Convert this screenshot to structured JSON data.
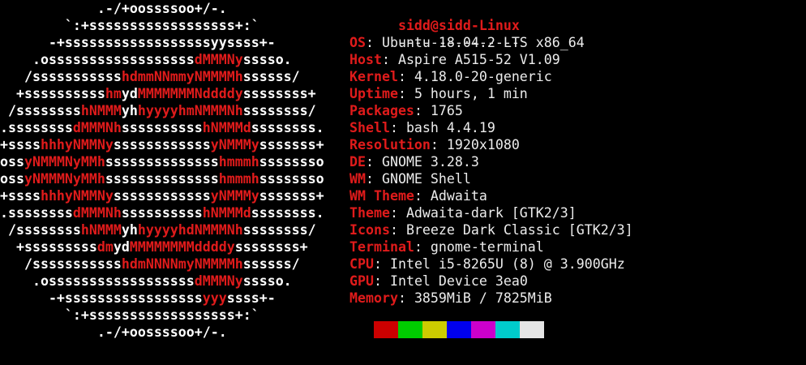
{
  "logo": {
    "lines": [
      [
        {
          "t": "            .-/+oossssoo+/-.",
          "c": "w"
        }
      ],
      [
        {
          "t": "        `:+ssssssssssssssssss+:`",
          "c": "w"
        }
      ],
      [
        {
          "t": "      -+ssssssssssssssssssyyssss+-",
          "c": "w"
        }
      ],
      [
        {
          "t": "    .ossssssssssssssssss",
          "c": "w"
        },
        {
          "t": "dMMMNy",
          "c": "r"
        },
        {
          "t": "sssso.",
          "c": "w"
        }
      ],
      [
        {
          "t": "   /sssssssssss",
          "c": "w"
        },
        {
          "t": "hdmmNNmmyNMMMMh",
          "c": "r"
        },
        {
          "t": "ssssss/",
          "c": "w"
        }
      ],
      [
        {
          "t": "  +ssssssssss",
          "c": "w"
        },
        {
          "t": "hm",
          "c": "r"
        },
        {
          "t": "yd",
          "c": "w"
        },
        {
          "t": "MMMMMMMNddddy",
          "c": "r"
        },
        {
          "t": "ssssssss+",
          "c": "w"
        }
      ],
      [
        {
          "t": " /ssssssss",
          "c": "w"
        },
        {
          "t": "hNMMM",
          "c": "r"
        },
        {
          "t": "yh",
          "c": "w"
        },
        {
          "t": "hyyyyhmNMMMNh",
          "c": "r"
        },
        {
          "t": "ssssssss/",
          "c": "w"
        }
      ],
      [
        {
          "t": ".ssssssss",
          "c": "w"
        },
        {
          "t": "dMMMNh",
          "c": "r"
        },
        {
          "t": "ssssssssss",
          "c": "w"
        },
        {
          "t": "hNMMMd",
          "c": "r"
        },
        {
          "t": "ssssssss.",
          "c": "w"
        }
      ],
      [
        {
          "t": "+ssss",
          "c": "w"
        },
        {
          "t": "hhhyNMMNy",
          "c": "r"
        },
        {
          "t": "ssssssssssss",
          "c": "w"
        },
        {
          "t": "yNMMMy",
          "c": "r"
        },
        {
          "t": "sssssss+",
          "c": "w"
        }
      ],
      [
        {
          "t": "oss",
          "c": "w"
        },
        {
          "t": "yNMMMNyMMh",
          "c": "r"
        },
        {
          "t": "ssssssssssssss",
          "c": "w"
        },
        {
          "t": "hmmmh",
          "c": "r"
        },
        {
          "t": "ssssssso",
          "c": "w"
        }
      ],
      [
        {
          "t": "oss",
          "c": "w"
        },
        {
          "t": "yNMMMNyMMh",
          "c": "r"
        },
        {
          "t": "ssssssssssssss",
          "c": "w"
        },
        {
          "t": "hmmmh",
          "c": "r"
        },
        {
          "t": "ssssssso",
          "c": "w"
        }
      ],
      [
        {
          "t": "+ssss",
          "c": "w"
        },
        {
          "t": "hhhyNMMNy",
          "c": "r"
        },
        {
          "t": "ssssssssssss",
          "c": "w"
        },
        {
          "t": "yNMMMy",
          "c": "r"
        },
        {
          "t": "sssssss+",
          "c": "w"
        }
      ],
      [
        {
          "t": ".ssssssss",
          "c": "w"
        },
        {
          "t": "dMMMNh",
          "c": "r"
        },
        {
          "t": "ssssssssss",
          "c": "w"
        },
        {
          "t": "hNMMMd",
          "c": "r"
        },
        {
          "t": "ssssssss.",
          "c": "w"
        }
      ],
      [
        {
          "t": " /ssssssss",
          "c": "w"
        },
        {
          "t": "hNMMM",
          "c": "r"
        },
        {
          "t": "yh",
          "c": "w"
        },
        {
          "t": "hyyyyhdNMMMNh",
          "c": "r"
        },
        {
          "t": "ssssssss/",
          "c": "w"
        }
      ],
      [
        {
          "t": "  +sssssssss",
          "c": "w"
        },
        {
          "t": "dm",
          "c": "r"
        },
        {
          "t": "yd",
          "c": "w"
        },
        {
          "t": "MMMMMMMMddddy",
          "c": "r"
        },
        {
          "t": "ssssssss+",
          "c": "w"
        }
      ],
      [
        {
          "t": "   /sssssssssss",
          "c": "w"
        },
        {
          "t": "hdmNNNNmyNMMMMh",
          "c": "r"
        },
        {
          "t": "ssssss/",
          "c": "w"
        }
      ],
      [
        {
          "t": "    .ossssssssssssssssss",
          "c": "w"
        },
        {
          "t": "dMMMNy",
          "c": "r"
        },
        {
          "t": "sssso.",
          "c": "w"
        }
      ],
      [
        {
          "t": "      -+sssssssssssssssss",
          "c": "w"
        },
        {
          "t": "yyy",
          "c": "r"
        },
        {
          "t": "ssss+-",
          "c": "w"
        }
      ],
      [
        {
          "t": "        `:+ssssssssssssssssss+:`",
          "c": "w"
        }
      ],
      [
        {
          "t": "            .-/+oossssoo+/-.",
          "c": "w"
        }
      ]
    ]
  },
  "header": {
    "userhost": "sidd@sidd-Linux",
    "separator": "---------------"
  },
  "info": [
    {
      "label": "OS",
      "value": "Ubuntu 18.04.2 LTS x86_64"
    },
    {
      "label": "Host",
      "value": "Aspire A515-52 V1.09"
    },
    {
      "label": "Kernel",
      "value": "4.18.0-20-generic"
    },
    {
      "label": "Uptime",
      "value": "5 hours, 1 min"
    },
    {
      "label": "Packages",
      "value": "1765"
    },
    {
      "label": "Shell",
      "value": "bash 4.4.19"
    },
    {
      "label": "Resolution",
      "value": "1920x1080"
    },
    {
      "label": "DE",
      "value": "GNOME 3.28.3"
    },
    {
      "label": "WM",
      "value": "GNOME Shell"
    },
    {
      "label": "WM Theme",
      "value": "Adwaita"
    },
    {
      "label": "Theme",
      "value": "Adwaita-dark [GTK2/3]"
    },
    {
      "label": "Icons",
      "value": "Breeze Dark Classic [GTK2/3]"
    },
    {
      "label": "Terminal",
      "value": "gnome-terminal"
    },
    {
      "label": "CPU",
      "value": "Intel i5-8265U (8) @ 3.900GHz"
    },
    {
      "label": "GPU",
      "value": "Intel Device 3ea0"
    },
    {
      "label": "Memory",
      "value": "3859MiB / 7825MiB"
    }
  ],
  "palette": [
    "#cc0000",
    "#00cc00",
    "#cccc00",
    "#0000ee",
    "#cc00cc",
    "#00cccc",
    "#e5e5e5"
  ]
}
